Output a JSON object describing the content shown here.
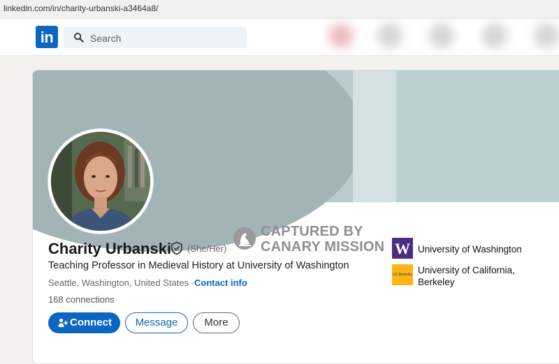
{
  "browser": {
    "url": "linkedin.com/in/charity-urbanski-a3464a8/"
  },
  "nav": {
    "logo_text": "in",
    "search_placeholder": "Search",
    "brand_color": "#0a66c2"
  },
  "profile": {
    "name": "Charity Urbanski",
    "pronouns": "(She/Her)",
    "headline": "Teaching Professor in Medieval History at University of Washington",
    "location": "Seattle, Washington, United States ·",
    "contact_label": "Contact info",
    "connections": "168 connections"
  },
  "actions": {
    "connect": "Connect",
    "message": "Message",
    "more": "More"
  },
  "watermark": {
    "line1": "CAPTURED BY",
    "line2": "CANARY MISSION"
  },
  "education": [
    {
      "name": "University of Washington",
      "logo_text": "W",
      "color": "#4b2e83"
    },
    {
      "name_line1": "University of California,",
      "name_line2": "Berkeley",
      "logo_text": "UC Berkeley",
      "color": "#fdb515"
    }
  ]
}
